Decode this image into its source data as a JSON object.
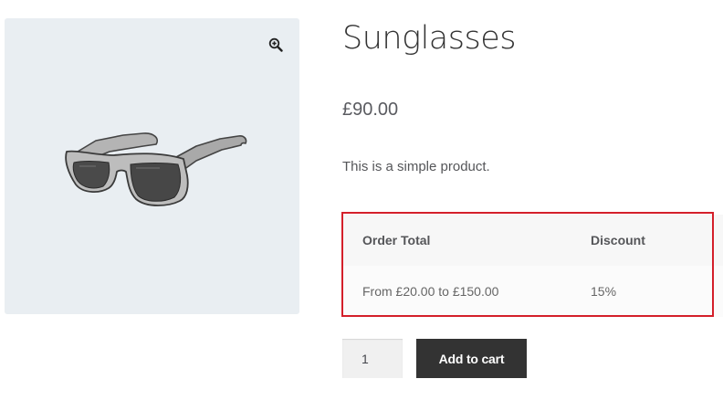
{
  "product": {
    "title": "Sunglasses",
    "price": "£90.00",
    "description": "This is a simple product."
  },
  "gallery": {
    "zoom_icon": "zoom-in-magnifier-icon",
    "background": "#e9eef2"
  },
  "discount_table": {
    "headers": [
      "Order Total",
      "Discount"
    ],
    "rows": [
      [
        "From £20.00 to £150.00",
        "15%"
      ]
    ],
    "highlight_color": "#d41f2a"
  },
  "cart": {
    "quantity": "1",
    "add_to_cart_label": "Add to cart",
    "button_color": "#333333"
  }
}
